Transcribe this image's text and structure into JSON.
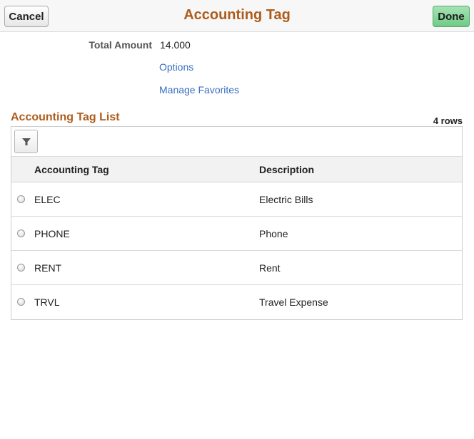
{
  "header": {
    "cancel_label": "Cancel",
    "title": "Accounting Tag",
    "done_label": "Done"
  },
  "summary": {
    "total_amount_label": "Total Amount",
    "total_amount_value": "14.000",
    "options_link": "Options",
    "manage_favorites_link": "Manage Favorites"
  },
  "list": {
    "title": "Accounting Tag List",
    "row_count": "4 rows",
    "filter_icon": "filter-icon",
    "columns": {
      "tag": "Accounting Tag",
      "description": "Description"
    },
    "rows": [
      {
        "tag": "ELEC",
        "description": "Electric Bills"
      },
      {
        "tag": "PHONE",
        "description": "Phone"
      },
      {
        "tag": "RENT",
        "description": "Rent"
      },
      {
        "tag": "TRVL",
        "description": "Travel Expense"
      }
    ]
  },
  "colors": {
    "title": "#ae5c1b",
    "link": "#3b6fc2",
    "done_button": "#6fcb87"
  }
}
